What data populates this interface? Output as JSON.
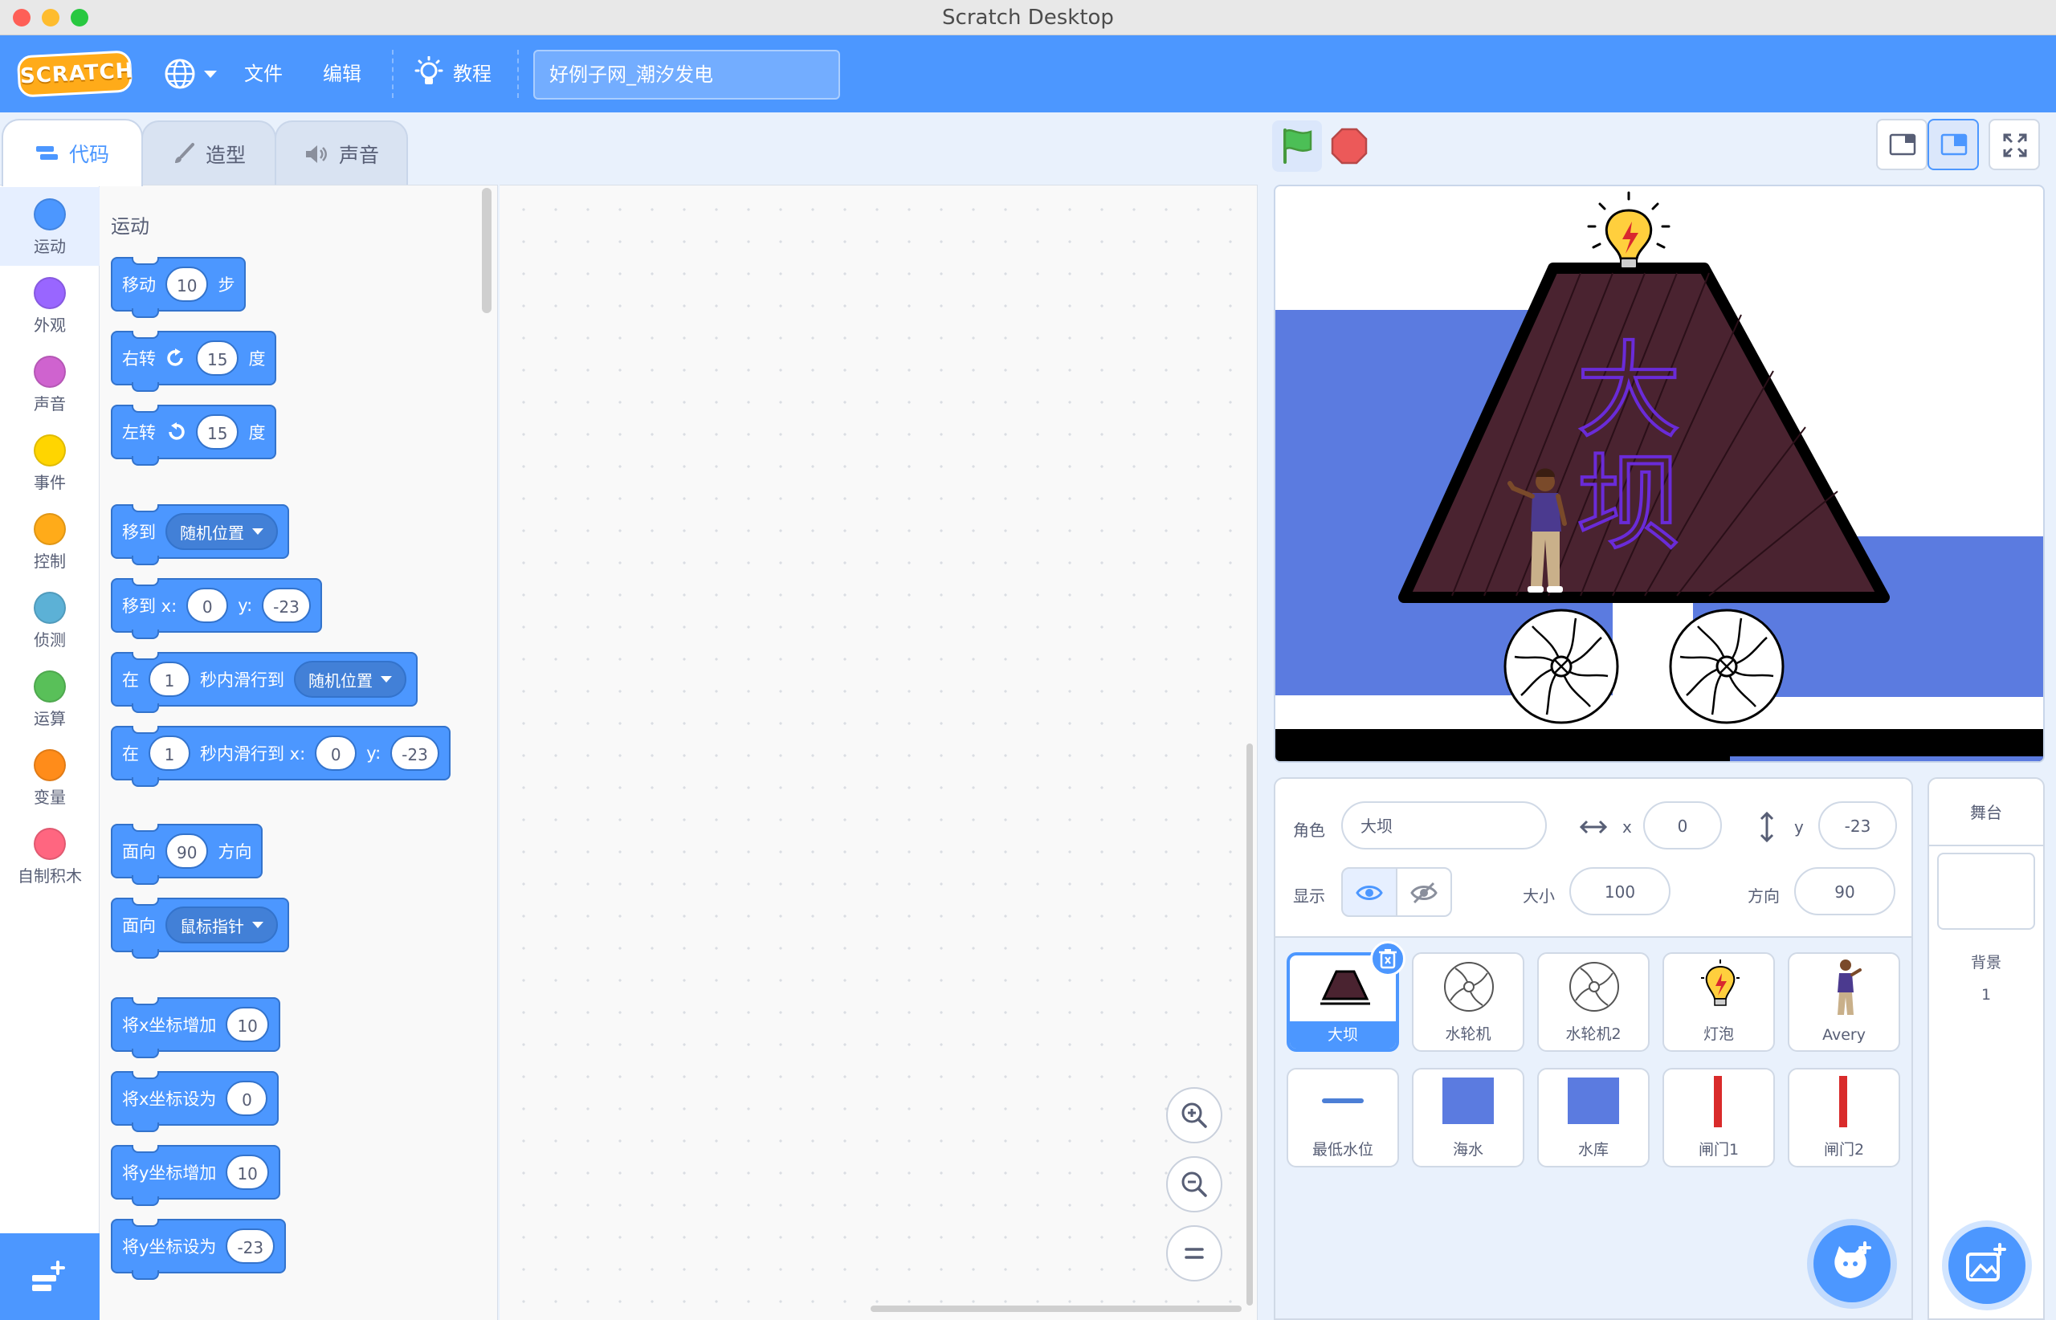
{
  "window": {
    "title": "Scratch Desktop"
  },
  "menubar": {
    "logo": "SCRATCH",
    "language_icon": "globe-icon",
    "file": "文件",
    "edit": "编辑",
    "tutorials": "教程",
    "project_title": "好例子网_潮汐发电"
  },
  "tabs": [
    {
      "label": "代码",
      "icon": "code-icon"
    },
    {
      "label": "造型",
      "icon": "brush-icon"
    },
    {
      "label": "声音",
      "icon": "speaker-icon"
    }
  ],
  "categories": [
    {
      "label": "运动",
      "color": "#4c97ff"
    },
    {
      "label": "外观",
      "color": "#9966ff"
    },
    {
      "label": "声音",
      "color": "#cf63cf"
    },
    {
      "label": "事件",
      "color": "#ffd500"
    },
    {
      "label": "控制",
      "color": "#ffab19"
    },
    {
      "label": "侦测",
      "color": "#5cb1d6"
    },
    {
      "label": "运算",
      "color": "#59c059"
    },
    {
      "label": "变量",
      "color": "#ff8c1a"
    },
    {
      "label": "自制积木",
      "color": "#ff6680"
    }
  ],
  "palette": {
    "heading": "运动",
    "blocks": {
      "move": {
        "text": "移动",
        "value": "10",
        "suffix": "步"
      },
      "turn_right": {
        "text": "右转",
        "value": "15",
        "suffix": "度"
      },
      "turn_left": {
        "text": "左转",
        "value": "15",
        "suffix": "度"
      },
      "goto": {
        "text": "移到",
        "option": "随机位置"
      },
      "goto_xy": {
        "text": "移到 x:",
        "x": "0",
        "ylabel": "y:",
        "y": "-23"
      },
      "glide": {
        "pre": "在",
        "secs": "1",
        "text": "秒内滑行到",
        "option": "随机位置"
      },
      "glide_xy": {
        "pre": "在",
        "secs": "1",
        "text": "秒内滑行到 x:",
        "x": "0",
        "ylabel": "y:",
        "y": "-23"
      },
      "point_dir": {
        "text": "面向",
        "value": "90",
        "suffix": "方向"
      },
      "point_towards": {
        "text": "面向",
        "option": "鼠标指针"
      },
      "change_x": {
        "text": "将x坐标增加",
        "value": "10"
      },
      "set_x": {
        "text": "将x坐标设为",
        "value": "0"
      },
      "change_y": {
        "text": "将y坐标增加",
        "value": "10"
      },
      "set_y": {
        "text": "将y坐标设为",
        "value": "-23"
      }
    }
  },
  "stage": {
    "dam_label_top": "大",
    "dam_label_bottom": "坝",
    "colors": {
      "water": "#5b7be0",
      "dam": "#4a2330",
      "frame": "#000000",
      "text": "#6a2bd8"
    }
  },
  "sprite_info": {
    "sprite_label": "角色",
    "sprite_name": "大坝",
    "x_label": "x",
    "x": "0",
    "y_label": "y",
    "y": "-23",
    "show_label": "显示",
    "size_label": "大小",
    "size": "100",
    "direction_label": "方向",
    "direction": "90"
  },
  "sprites": [
    {
      "name": "大坝",
      "selected": true
    },
    {
      "name": "水轮机"
    },
    {
      "name": "水轮机2"
    },
    {
      "name": "灯泡"
    },
    {
      "name": "Avery"
    },
    {
      "name": "最低水位"
    },
    {
      "name": "海水"
    },
    {
      "name": "水库"
    },
    {
      "name": "闸门1"
    },
    {
      "name": "闸门2"
    }
  ],
  "stage_panel": {
    "title": "舞台",
    "backdrops_label": "背景",
    "backdrops_count": "1"
  }
}
